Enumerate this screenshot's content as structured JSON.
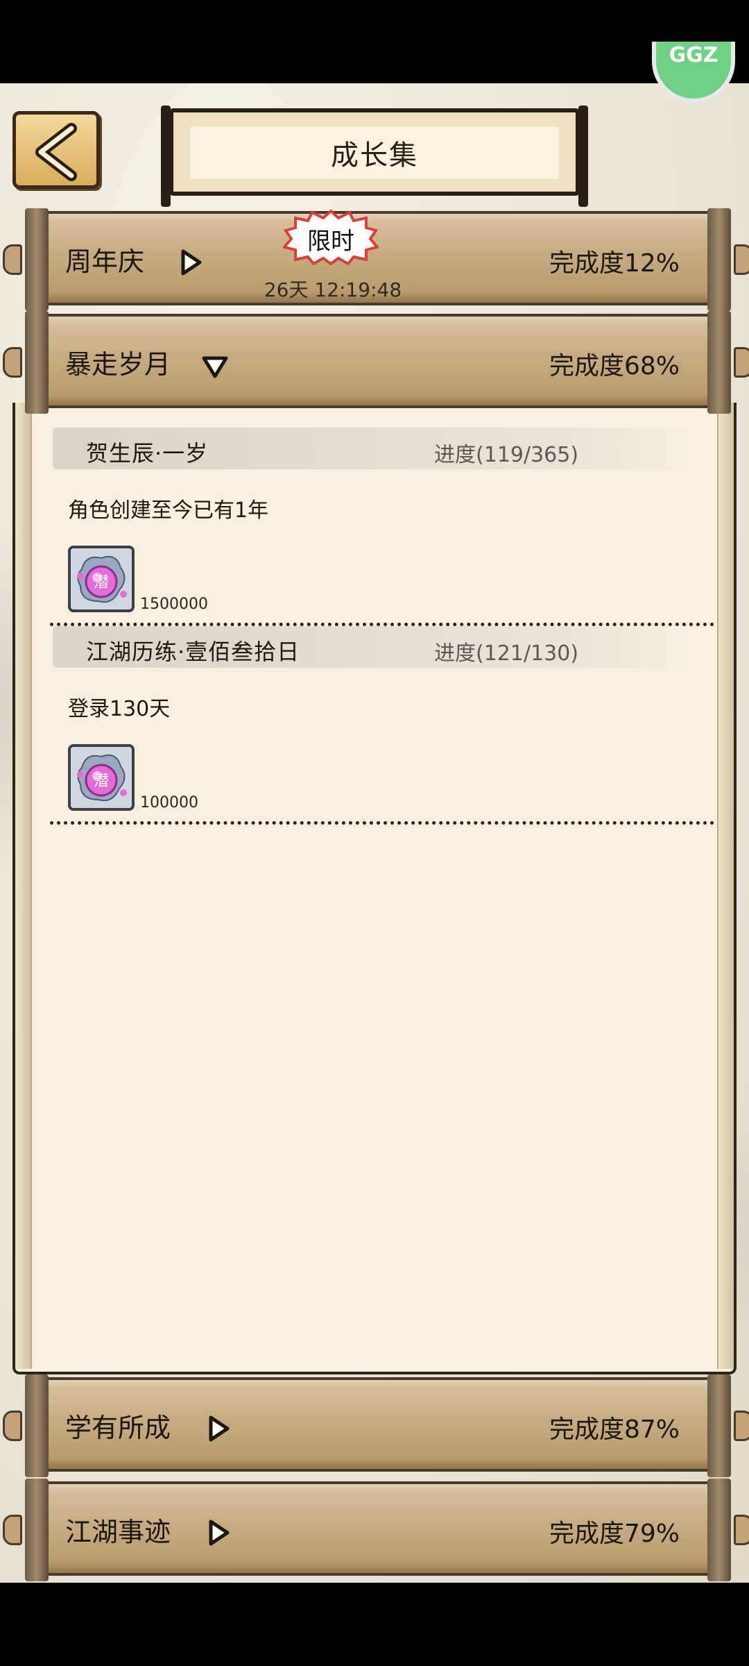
{
  "status_badge": {
    "text": "GGZ"
  },
  "header": {
    "title": "成长集"
  },
  "categories": [
    {
      "label": "周年庆",
      "progress": "完成度12%",
      "limited_badge": "限时",
      "countdown": "26天 12:19:48"
    },
    {
      "label": "暴走岁月",
      "progress": "完成度68%"
    },
    {
      "label": "学有所成",
      "progress": "完成度87%"
    },
    {
      "label": "江湖事迹",
      "progress": "完成度79%"
    }
  ],
  "tasks": [
    {
      "name": "贺生辰·一岁",
      "progress": "进度(119/365)",
      "desc": "角色创建至今已有1年",
      "reward_qty": "1500000",
      "reward_icon": "purple-orb-icon"
    },
    {
      "name": "江湖历练·壹佰叁拾日",
      "progress": "进度(121/130)",
      "desc": "登录130天",
      "reward_qty": "100000",
      "reward_icon": "purple-orb-icon"
    }
  ],
  "colors": {
    "scroll_bar": "#c8ab82",
    "panel": "#f8efdf",
    "back_button": "#d9ad5c",
    "badge_red": "#d8403a"
  }
}
